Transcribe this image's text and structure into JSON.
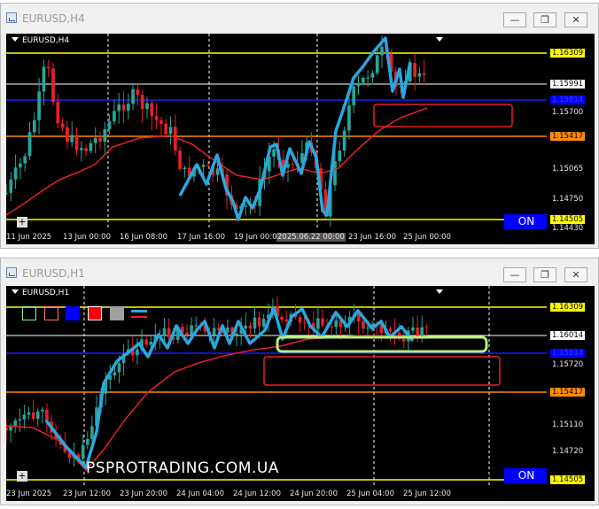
{
  "windows": [
    {
      "title": "EURUSD,H4",
      "symbol_label": "EURUSD,H4",
      "price_tags": [
        {
          "text": "1.16309",
          "color": "#ffff00",
          "text_color": "#000000"
        },
        {
          "text": "1.15991",
          "color": "#ffffff",
          "text_color": "#000000"
        },
        {
          "text": "1.15814",
          "color": "#0000ff",
          "text_color": "#0000ff"
        },
        {
          "text": "1.15417",
          "color": "#ff8c00",
          "text_color": "#000000"
        },
        {
          "text": "1.14505",
          "color": "#ffff00",
          "text_color": "#000000"
        }
      ],
      "y_labels": [
        "1.15700",
        "1.15065",
        "1.14750",
        "1.14430"
      ],
      "x_labels": [
        "11 Jun 2025",
        "13 Jun 00:00",
        "16 Jun 08:00",
        "17 Jun 16:00",
        "19 Jun 00:00",
        "2025.06.22 00:00",
        "23 Jun 16:00",
        "25 Jun 00:00"
      ],
      "on_button": "ON",
      "plus_button": "+"
    },
    {
      "title": "EURUSD,H1",
      "symbol_label": "EURUSD,H1",
      "price_tags": [
        {
          "text": "1.16309",
          "color": "#ffff00",
          "text_color": "#000000"
        },
        {
          "text": "1.16014",
          "color": "#ffffff",
          "text_color": "#000000"
        },
        {
          "text": "1.15814",
          "color": "#0000ff",
          "text_color": "#0000ff"
        },
        {
          "text": "1.15417",
          "color": "#ff8c00",
          "text_color": "#000000"
        },
        {
          "text": "1.14505",
          "color": "#ffff00",
          "text_color": "#000000"
        }
      ],
      "y_labels": [
        "1.15720",
        "1.15110",
        "1.14720"
      ],
      "x_labels": [
        "23 Jun 2025",
        "23 Jun 12:00",
        "23 Jun 20:00",
        "24 Jun 04:00",
        "24 Jun 12:00",
        "24 Jun 20:00",
        "25 Jun 04:00",
        "25 Jun 12:00"
      ],
      "on_button": "ON",
      "plus_button": "+",
      "watermark": "PSPROTRADING.COM.UA",
      "toolbar_swatches": [
        "#90ee90",
        "#ff8060",
        "#0000ff",
        "#ff0000",
        "#a0a0a0"
      ]
    }
  ],
  "window_controls": [
    "minimize",
    "restore",
    "close"
  ],
  "colors": {
    "resistance": "#ffff00",
    "support": "#ff8c00",
    "blue_level": "#0000ff",
    "bull_candle": "#26a69a",
    "bear_candle": "#e8202a",
    "moving_average": "#e8202a",
    "zigzag": "#29a8e0",
    "zone_outline": "#e8202a",
    "green_zone": "#90ee90"
  }
}
